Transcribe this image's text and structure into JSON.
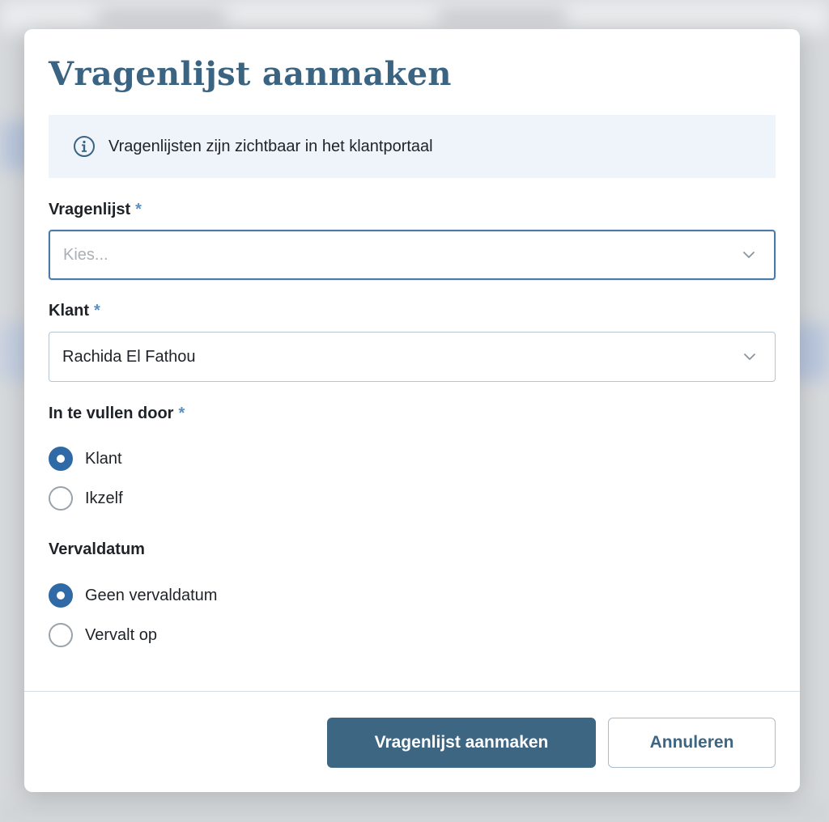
{
  "modal": {
    "title": "Vragenlijst aanmaken",
    "info": {
      "icon": "info-icon",
      "text": "Vragenlijsten zijn zichtbaar in het klantportaal"
    },
    "questionnaire_field": {
      "label": "Vragenlijst",
      "required_marker": "*",
      "placeholder": "Kies...",
      "value": ""
    },
    "client_field": {
      "label": "Klant",
      "required_marker": "*",
      "value": "Rachida El Fathou"
    },
    "filled_by": {
      "label": "In te vullen door",
      "required_marker": "*",
      "options": [
        {
          "label": "Klant",
          "checked": true
        },
        {
          "label": "Ikzelf",
          "checked": false
        }
      ]
    },
    "expiry": {
      "label": "Vervaldatum",
      "options": [
        {
          "label": "Geen vervaldatum",
          "checked": true
        },
        {
          "label": "Vervalt op",
          "checked": false
        }
      ]
    },
    "footer": {
      "primary_label": "Vragenlijst aanmaken",
      "secondary_label": "Annuleren"
    }
  },
  "colors": {
    "title": "#3a6482",
    "info_bg": "#eef4fa",
    "required": "#5a8fc4",
    "radio_checked": "#2f6aa6",
    "primary_button": "#3d6683",
    "focus_border": "#4a7aa8"
  }
}
